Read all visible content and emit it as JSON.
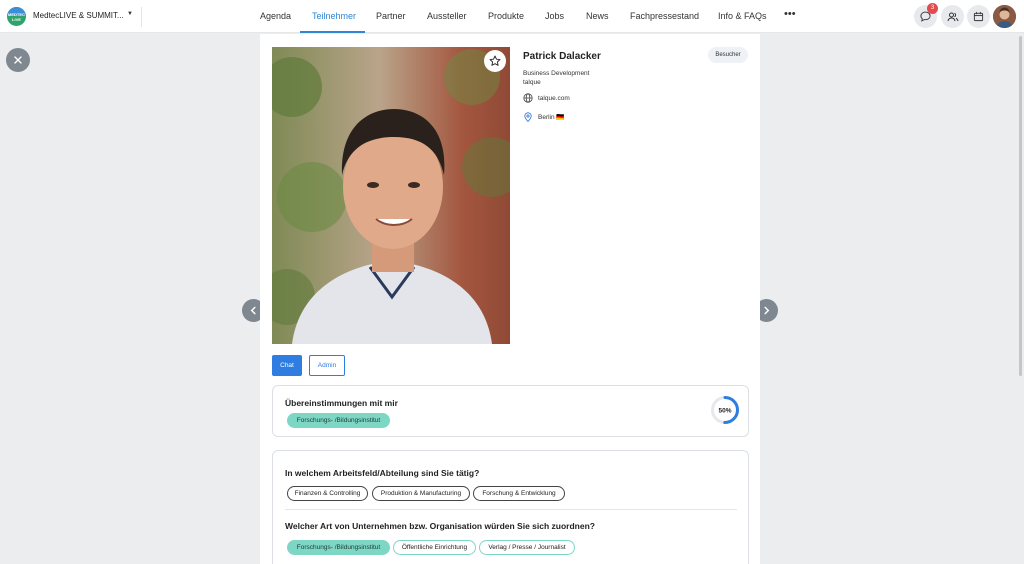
{
  "header": {
    "logo_text": "MEDTEC LIVE",
    "event_name": "MedtecLIVE & SUMMIT...",
    "nav": [
      {
        "label": "Agenda",
        "active": false
      },
      {
        "label": "Teilnehmer",
        "active": true
      },
      {
        "label": "Partner",
        "active": false
      },
      {
        "label": "Aussteller",
        "active": false
      },
      {
        "label": "Produkte",
        "active": false
      },
      {
        "label": "Jobs",
        "active": false
      },
      {
        "label": "News",
        "active": false
      },
      {
        "label": "Fachpressestand",
        "active": false
      },
      {
        "label": "Info & FAQs",
        "active": false
      }
    ],
    "more_label": "•••",
    "chat_badge_count": "3",
    "icons": [
      "chat-bubble-icon",
      "people-icon",
      "calendar-icon",
      "user-avatar"
    ],
    "accent_color": "#2f86d4"
  },
  "profile": {
    "name": "Patrick Dalacker",
    "role_badge": "Besucher",
    "job_title": "Business Development",
    "company": "talque",
    "website": "talque.com",
    "location": "Berlin 🇩🇪",
    "buttons": {
      "chat": "Chat",
      "admin": "Admin"
    }
  },
  "matches": {
    "title": "Übereinstimmungen mit mir",
    "tags": [
      "Forschungs- /Bildungsinstitut"
    ],
    "percent": 50,
    "percent_label": "50%"
  },
  "questions": [
    {
      "question": "In welchem Arbeitsfeld/Abteilung sind Sie tätig?",
      "answers": [
        {
          "label": "Finanzen & Controlling",
          "style": "outline"
        },
        {
          "label": "Produktion & Manufacturing",
          "style": "outline"
        },
        {
          "label": "Forschung & Entwicklung",
          "style": "outline"
        }
      ]
    },
    {
      "question": "Welcher Art von Unternehmen bzw. Organisation würden Sie sich zuordnen?",
      "answers": [
        {
          "label": "Forschungs- /Bildungsinstitut",
          "style": "teal"
        },
        {
          "label": "Öffentliche Einrichtung",
          "style": "teal-outline"
        },
        {
          "label": "Verlag / Presse / Journalist",
          "style": "teal-outline"
        }
      ]
    }
  ],
  "colors": {
    "primary": "#2f7de1",
    "match_teal": "#7ed6c4",
    "progress": "#2f7de1"
  }
}
